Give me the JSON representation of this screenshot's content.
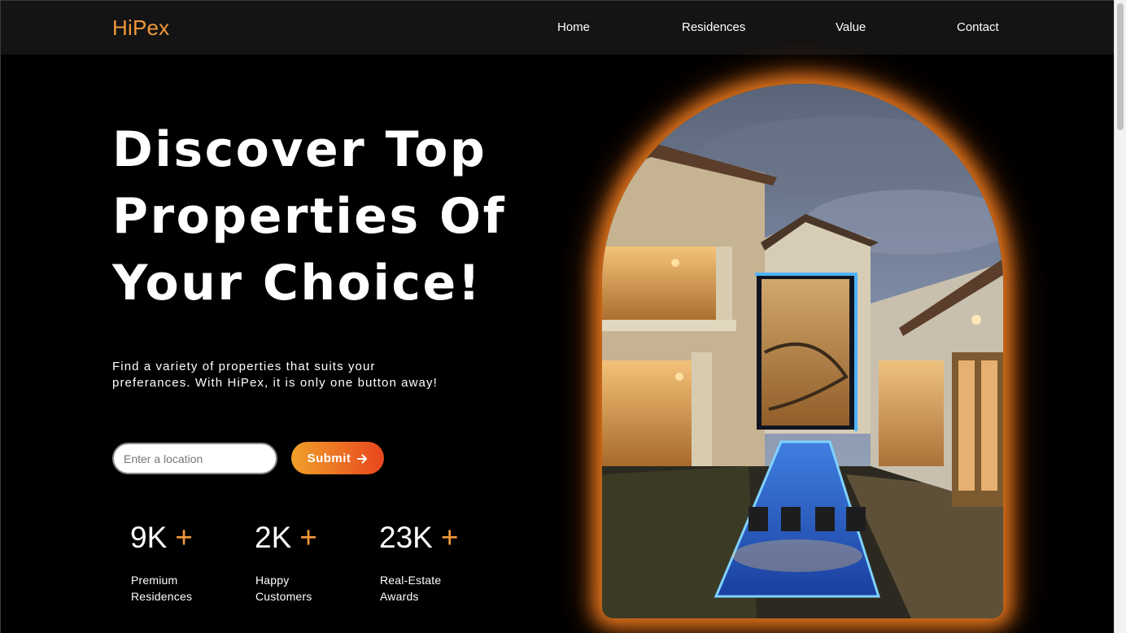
{
  "header": {
    "logo": "HiPex",
    "nav": [
      "Home",
      "Residences",
      "Value",
      "Contact"
    ]
  },
  "hero": {
    "title_lines": [
      "Discover Top",
      "Properties Of",
      "Your Choice!"
    ],
    "subtitle_lines": [
      "Find a variety of properties that suits your",
      "preferances. With HiPex, it is only one button away!"
    ],
    "search": {
      "placeholder": "Enter a location",
      "value": ""
    },
    "submit_label": "Submit",
    "submit_icon": "arrow-right-icon"
  },
  "stats": [
    {
      "number": "9K",
      "plus": "+",
      "label_lines": [
        "Premium",
        "Residences"
      ]
    },
    {
      "number": "2K",
      "plus": "+",
      "label_lines": [
        "Happy",
        "Customers"
      ]
    },
    {
      "number": "23K",
      "plus": "+",
      "label_lines": [
        "Real-Estate",
        "Awards"
      ]
    }
  ],
  "colors": {
    "accent": "#f0983a",
    "button_gradient_start": "#f0a02a",
    "button_gradient_end": "#e8461d",
    "background": "#000000",
    "header_bg": "#141414"
  }
}
